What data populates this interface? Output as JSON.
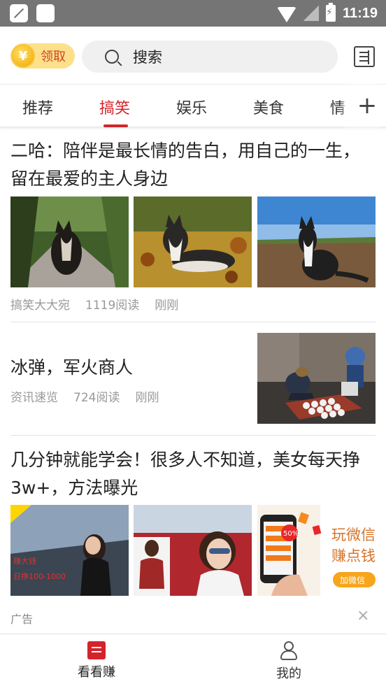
{
  "status_bar": {
    "time": "11:19"
  },
  "header": {
    "coin_button_label": "领取",
    "coin_symbol": "¥",
    "search_placeholder": "搜索"
  },
  "tabs": [
    {
      "label": "推荐",
      "active": false
    },
    {
      "label": "搞笑",
      "active": true
    },
    {
      "label": "娱乐",
      "active": false
    },
    {
      "label": "美食",
      "active": false
    },
    {
      "label": "情",
      "active": false
    }
  ],
  "tab_add_label": "+",
  "feed": [
    {
      "title": "二哈：陪伴是最长情的告白，用自己的一生，留在最爱的主人身边",
      "source": "搞笑大大宛",
      "reads": "1119阅读",
      "time": "刚刚"
    },
    {
      "title": "冰弹，军火商人",
      "source": "资讯速览",
      "reads": "724阅读",
      "time": "刚刚"
    },
    {
      "title": "几分钟就能学会！很多人不知道，美女每天挣3w+，方法曝光",
      "ad_label": "广告",
      "ad_image_texts": [
        "赚大钱",
        "日挣100-1000",
        "玩微信",
        "赚点钱",
        "加微信",
        "50%"
      ]
    }
  ],
  "bottom_nav": [
    {
      "label": "看看赚",
      "active": true
    },
    {
      "label": "我的",
      "active": false
    }
  ],
  "colors": {
    "accent": "#d4242b",
    "status_bar": "#757575",
    "coin_bg": "#fde08a"
  }
}
